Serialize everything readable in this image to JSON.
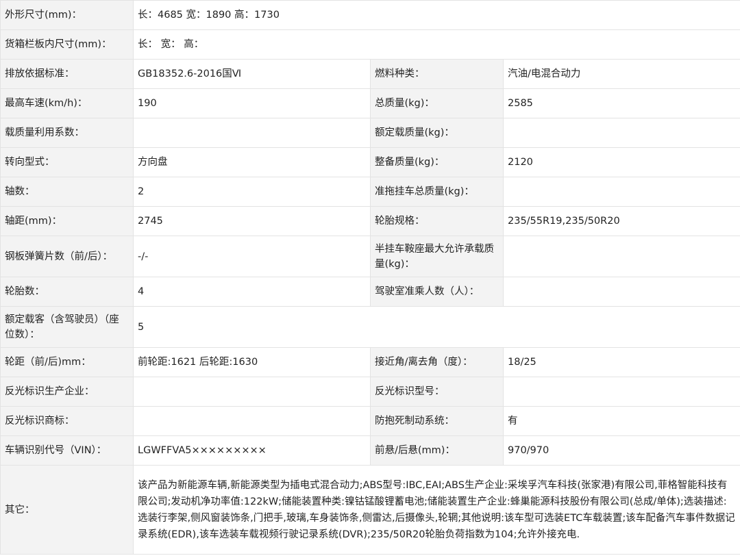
{
  "rows": {
    "r1": {
      "label": "外形尺寸(mm)：",
      "value": "长：4685 宽：1890 高：1730"
    },
    "r2": {
      "label": "货箱栏板内尺寸(mm)：",
      "value": "长：  宽：  高："
    },
    "r3": {
      "label": "排放依据标准：",
      "value": "GB18352.6-2016国Ⅵ",
      "label2": "燃料种类：",
      "value2": "汽油/电混合动力"
    },
    "r4": {
      "label": "最高车速(km/h)：",
      "value": "190",
      "label2": "总质量(kg)：",
      "value2": "2585"
    },
    "r5": {
      "label": "载质量利用系数：",
      "value": "",
      "label2": "额定载质量(kg)：",
      "value2": ""
    },
    "r6": {
      "label": "转向型式：",
      "value": "方向盘",
      "label2": "整备质量(kg)：",
      "value2": "2120"
    },
    "r7": {
      "label": "轴数：",
      "value": "2",
      "label2": "准拖挂车总质量(kg)：",
      "value2": ""
    },
    "r8": {
      "label": "轴距(mm)：",
      "value": "2745",
      "label2": "轮胎规格：",
      "value2": "235/55R19,235/50R20"
    },
    "r9": {
      "label": "钢板弹簧片数（前/后）：",
      "value": "-/-",
      "label2": "半挂车鞍座最大允许承载质量(kg)：",
      "value2": ""
    },
    "r10": {
      "label": "轮胎数：",
      "value": "4",
      "label2": "驾驶室准乘人数（人）：",
      "value2": ""
    },
    "r11": {
      "label": "额定载客（含驾驶员）（座位数）：",
      "value": "5"
    },
    "r12": {
      "label": "轮距（前/后)mm：",
      "value": "前轮距:1621 后轮距:1630",
      "label2": "接近角/离去角（度）：",
      "value2": "18/25"
    },
    "r13": {
      "label": "反光标识生产企业：",
      "value": "",
      "label2": "反光标识型号：",
      "value2": ""
    },
    "r14": {
      "label": "反光标识商标：",
      "value": "",
      "label2": "防抱死制动系统：",
      "value2": "有"
    },
    "r15": {
      "label": "车辆识别代号（VIN）：",
      "value": "LGWFFVA5×××××××××",
      "label2": "前悬/后悬(mm)：",
      "value2": "970/970"
    },
    "r16": {
      "label": "其它：",
      "value": "该产品为新能源车辆,新能源类型为插电式混合动力;ABS型号:IBC,EAI;ABS生产企业:采埃孚汽车科技(张家港)有限公司,菲格智能科技有限公司;发动机净功率值:122kW;储能装置种类:镍钴锰酸锂蓄电池;储能装置生产企业:蜂巢能源科技股份有限公司(总成/单体);选装描述:选装行李架,侧风窗装饰条,门把手,玻璃,车身装饰条,侧雷达,后摄像头,轮辋;其他说明:该车型可选装ETC车载装置;该车配备汽车事件数据记录系统(EDR),该车选装车载视频行驶记录系统(DVR);235/50R20轮胎负荷指数为104;允许外接充电."
    }
  },
  "colors": {
    "label_bg": "#f3f3f3",
    "border": "#e3e3e3",
    "text": "#222222"
  }
}
